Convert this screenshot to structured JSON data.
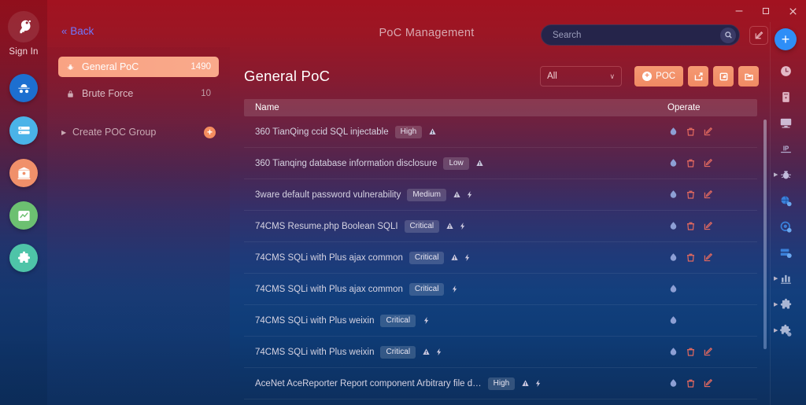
{
  "window": {
    "minimize_label": "minimize",
    "maximize_label": "maximize",
    "close_label": "close"
  },
  "left_rail": {
    "logo_name": "app-logo",
    "signin_label": "Sign In",
    "items": [
      {
        "name": "spy-icon",
        "color": "#1d6fd0"
      },
      {
        "name": "database-icon",
        "color": "#4ab3e8"
      },
      {
        "name": "bug-bank-icon",
        "color": "#f0906a"
      },
      {
        "name": "chart-icon",
        "color": "#6cc071"
      },
      {
        "name": "puzzle-icon",
        "color": "#4ec4a8"
      }
    ]
  },
  "header": {
    "back_label": "Back",
    "back_chevron": "«",
    "title": "PoC Management",
    "search": {
      "placeholder": "Search",
      "value": "",
      "icon": "search-icon"
    },
    "compose_icon": "compose-icon"
  },
  "nav_panel": {
    "items": [
      {
        "label": "General PoC",
        "count": "1490",
        "icon": "bug-icon",
        "active": true
      },
      {
        "label": "Brute Force",
        "count": "10",
        "icon": "lock-icon",
        "active": false
      }
    ],
    "create_group": {
      "label": "Create POC Group",
      "triangle": "▶",
      "add_icon": "plus-circle-icon",
      "add_symbol": "+"
    }
  },
  "main": {
    "page_title": "General PoC",
    "filter": {
      "value": "All",
      "chevron": "∨"
    },
    "buttons": [
      {
        "name": "add-poc-button",
        "label": "POC",
        "icon": "plus-circle-icon"
      },
      {
        "name": "export-button",
        "label": "",
        "icon": "export-icon"
      },
      {
        "name": "import-button",
        "label": "",
        "icon": "import-icon"
      },
      {
        "name": "folder-button",
        "label": "",
        "icon": "folder-icon"
      }
    ],
    "table": {
      "columns": {
        "name": "Name",
        "operate": "Operate"
      },
      "rows": [
        {
          "name": "360 TianQing ccid SQL injectable",
          "severity": "High",
          "flags": [
            "alert-icon"
          ],
          "ops": [
            "run-icon",
            "delete-icon",
            "edit-icon"
          ]
        },
        {
          "name": "360 Tianqing database information disclosure",
          "severity": "Low",
          "flags": [
            "alert-icon"
          ],
          "ops": [
            "run-icon",
            "delete-icon",
            "edit-icon"
          ]
        },
        {
          "name": "3ware default password vulnerability",
          "severity": "Medium",
          "flags": [
            "alert-icon",
            "bolt-icon"
          ],
          "ops": [
            "run-icon",
            "delete-icon",
            "edit-icon"
          ]
        },
        {
          "name": "74CMS Resume.php Boolean SQLI",
          "severity": "Critical",
          "flags": [
            "alert-icon",
            "bolt-icon"
          ],
          "ops": [
            "run-icon",
            "delete-icon",
            "edit-icon"
          ]
        },
        {
          "name": "74CMS SQLi with Plus ajax common",
          "severity": "Critical",
          "flags": [
            "alert-icon",
            "bolt-icon"
          ],
          "ops": [
            "run-icon",
            "delete-icon",
            "edit-icon"
          ]
        },
        {
          "name": "74CMS SQLi with Plus ajax common",
          "severity": "Critical",
          "flags": [
            "bolt-icon"
          ],
          "ops": [
            "run-icon"
          ]
        },
        {
          "name": "74CMS SQLi with Plus weixin",
          "severity": "Critical",
          "flags": [
            "bolt-icon"
          ],
          "ops": [
            "run-icon"
          ]
        },
        {
          "name": "74CMS SQLi with Plus weixin",
          "severity": "Critical",
          "flags": [
            "alert-icon",
            "bolt-icon"
          ],
          "ops": [
            "run-icon",
            "delete-icon",
            "edit-icon"
          ]
        },
        {
          "name": "AceNet AceReporter Report component Arbitrary file d…",
          "severity": "High",
          "flags": [
            "alert-icon",
            "bolt-icon"
          ],
          "ops": [
            "run-icon",
            "delete-icon",
            "edit-icon"
          ]
        }
      ]
    }
  },
  "right_rail": {
    "add_label": "+",
    "items": [
      {
        "name": "clock-icon",
        "expandable": false
      },
      {
        "name": "server-icon",
        "expandable": false
      },
      {
        "name": "monitor-icon",
        "expandable": false
      },
      {
        "name": "ip-icon",
        "expandable": false
      },
      {
        "name": "bug-icon",
        "expandable": true
      },
      {
        "name": "globe-vuln-icon",
        "expandable": false
      },
      {
        "name": "scan-icon",
        "expandable": false
      },
      {
        "name": "database-lock-icon",
        "expandable": false
      },
      {
        "name": "bar-chart-icon",
        "expandable": true
      },
      {
        "name": "puzzle-icon",
        "expandable": true
      },
      {
        "name": "plugin-settings-icon",
        "expandable": true
      }
    ]
  },
  "colors": {
    "accent_orange": "#f08a63",
    "accent_blue": "#2e8ef7",
    "back_link": "#6f78ff",
    "bg_top": "#a21220",
    "bg_bottom": "#0d2f5d"
  }
}
